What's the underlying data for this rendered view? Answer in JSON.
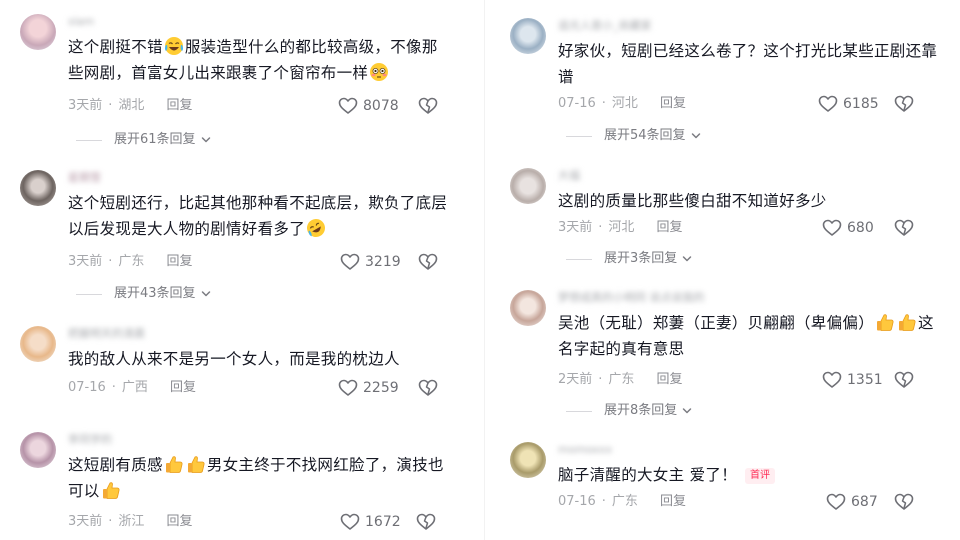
{
  "comments": [
    {
      "username": "slam",
      "text": [
        "这个剧挺不错",
        "服装造型什么的都比较高级，不像那些网剧，首富女儿出来跟裹了个窗帘布一样"
      ],
      "time": "3天前",
      "location": "湖北",
      "reply_label": "回复",
      "likes": "8078",
      "expand": "展开61条回复"
    },
    {
      "username": "星期雪",
      "text": [
        "这个短剧还行，比起其他那种看不起底层，欺负了底层以后发现是大人物的剧情好看多了"
      ],
      "time": "3天前",
      "location": "广东",
      "reply_label": "回复",
      "likes": "3219",
      "expand": "展开43条回复"
    },
    {
      "username": "把握明天的清晨",
      "text": [
        "我的敌人从来不是另一个女人，而是我的枕边人"
      ],
      "time": "07-16",
      "location": "广西",
      "reply_label": "回复",
      "likes": "2259",
      "expand": ""
    },
    {
      "username": "李同学的",
      "text": [
        "这短剧有质感",
        "男女主终于不找网红脸了，演技也可以"
      ],
      "time": "3天前",
      "location": "浙江",
      "reply_label": "回复",
      "likes": "1672",
      "expand": ""
    },
    {
      "username": "追光人是小_收藏家",
      "text": [
        "好家伙，短剧已经这么卷了？这个打光比某些正剧还靠谱"
      ],
      "time": "07-16",
      "location": "河北",
      "reply_label": "回复",
      "likes": "6185",
      "expand": "展开54条回复"
    },
    {
      "username": "大福",
      "text": [
        "这剧的质量比那些傻白甜不知道好多少"
      ],
      "time": "3天前",
      "location": "河北",
      "reply_label": "回复",
      "likes": "680",
      "expand": "展开3条回复"
    },
    {
      "username": "梦想成真的小明同 说点说我的",
      "text": [
        "吴池（无耻）郑萋（正妻）贝翩翩（卑偏偏）",
        "这名字起的真有意思"
      ],
      "time": "2天前",
      "location": "广东",
      "reply_label": "回复",
      "likes": "1351",
      "expand": "展开8条回复"
    },
    {
      "username": "momoxxx",
      "text": [
        "脑子清醒的大女主 爱了！"
      ],
      "badge": "首评",
      "time": "07-16",
      "location": "广东",
      "reply_label": "回复",
      "likes": "687",
      "expand": ""
    }
  ],
  "icons": {
    "like": "heart-outline-icon",
    "dislike": "broken-heart-icon",
    "expand": "chevron-down-icon",
    "emoji_tears": "face-with-tears-of-joy-emoji",
    "emoji_flushed": "flushed-face-emoji",
    "emoji_rofl": "rolling-on-floor-laughing-emoji",
    "emoji_thumbs": "thumbs-up-emoji"
  },
  "colors": {
    "text": "#161823",
    "meta": "#a5a7ab",
    "badge": "#fe2c55"
  }
}
